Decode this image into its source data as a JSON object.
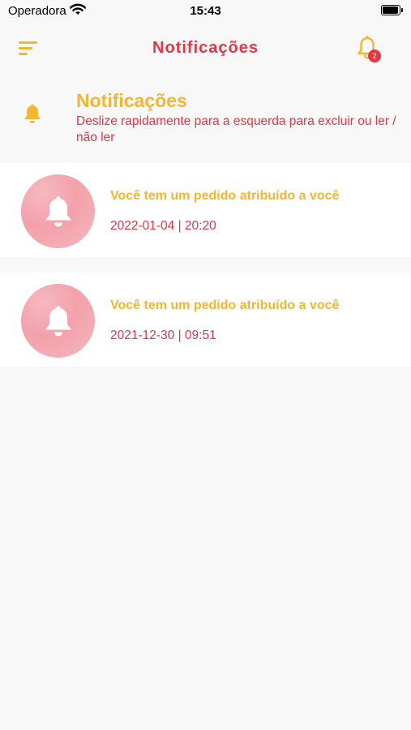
{
  "status_bar": {
    "carrier": "Operadora",
    "time": "15:43"
  },
  "header": {
    "title": "Notificações",
    "menu_icon": "menu-icon",
    "bell_icon": "bell-icon",
    "badge_count": "2"
  },
  "info": {
    "icon": "bell-icon",
    "title": "Notificações",
    "subtitle": "Deslize rapidamente para a esquerda para excluir ou ler / não ler"
  },
  "notifications": [
    {
      "icon": "bell-icon",
      "title": "Você tem um pedido atribuído a você",
      "datetime": "2022-01-04 | 20:20"
    },
    {
      "icon": "bell-icon",
      "title": "Você tem um pedido atribuído a você",
      "datetime": "2021-12-30 | 09:51"
    }
  ],
  "colors": {
    "accent_yellow": "#f2b632",
    "accent_red": "#e23744",
    "background": "#f8f8f8",
    "card": "#ffffff"
  }
}
